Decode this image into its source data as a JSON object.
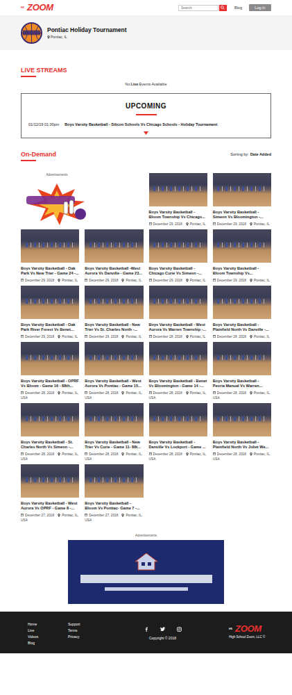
{
  "header": {
    "logo": {
      "small": "HS",
      "name": "ZOOM"
    },
    "search": {
      "placeholder": "Search"
    },
    "links": [
      "Blog"
    ],
    "login": "Log In"
  },
  "profile": {
    "name": "Pontiac Holiday Tournament",
    "location": "Pontiac, IL"
  },
  "live": {
    "title": "LIVE STREAMS",
    "empty": {
      "before": "No",
      "bold": "Live",
      "after": "Events Available"
    }
  },
  "upcoming": {
    "title": "UPCOMING",
    "events": [
      {
        "time": "01/12/19 01:30pm",
        "title": "Boys Varsity Basketball - Silicon Schools Vs Chicago Schools - Holiday Tournament"
      }
    ]
  },
  "on_demand": {
    "title": "On-Demand",
    "sort_label": "Sorting by:",
    "sort_value": "Date Added"
  },
  "side_ad": {
    "label": "Advertisements"
  },
  "videos": [
    {
      "title": "Boys Varsity Basketball - Bloom Township Vs Chicago...",
      "date": "December 29, 2018",
      "location": "Pontiac, IL"
    },
    {
      "title": "Boys Varsity Basketball - Simeon Vs Bloomington -...",
      "date": "December 29, 2018",
      "location": "Pontiac, IL"
    },
    {
      "title": "Boys Varsity Basketball - Oak Park Vs New Trier - Game 24 -...",
      "date": "December 29, 2018",
      "location": "Pontiac, IL"
    },
    {
      "title": "Boys Varsity Basketball -West Aurora Vs Danville - Game 23...",
      "date": "December 29, 2018",
      "location": "Pontiac, IL"
    },
    {
      "title": "Boys Varsity Basketball - Chicago Curie Vs Simeon -...",
      "date": "December 29, 2018",
      "location": "Pontiac, IL"
    },
    {
      "title": "Boys Varsity Basketball - Bloom Township Vs...",
      "date": "December 29, 2018",
      "location": "Pontiac, IL"
    },
    {
      "title": "Boys Varsity Basketball - Oak Park River Forest Vs Benet...",
      "date": "December 29, 2018",
      "location": "Pontiac, IL"
    },
    {
      "title": "Boys Varsity Basketball - New Trier Vs St. Charles North -...",
      "date": "December 29, 2018",
      "location": "Pontiac, IL"
    },
    {
      "title": "Boys Varsity Basketball - West Aurora Vs Warren Township -...",
      "date": "December 28, 2018",
      "location": "Pontiac, IL"
    },
    {
      "title": "Boys Varsity Basketball - Plainfield North Vs Danville -...",
      "date": "December 28, 2018",
      "location": "Pontiac, IL"
    },
    {
      "title": "Boys Varsity Basketball - OPRF Vs Bloom - Game 16 - 88th...",
      "date": "December 28, 2018",
      "location": "Pontiac, IL, USA"
    },
    {
      "title": "Boys Varsity Basketball - West Aurora Vs Pontiac - Game 15...",
      "date": "December 28, 2018",
      "location": "Pontiac, IL, USA"
    },
    {
      "title": "Boys Varsity Basketball - Benet Vs Bloomington - Game 14 -...",
      "date": "December 28, 2018",
      "location": "Pontiac, IL, USA"
    },
    {
      "title": "Boys Varsity Basketball - Peoria Manual Vs Warren...",
      "date": "December 28, 2018",
      "location": "Pontiac, IL, USA"
    },
    {
      "title": "Boys Varsity Basketball - St. Charles North Vs Simeon -...",
      "date": "December 28, 2018",
      "location": "Pontiac, IL, USA"
    },
    {
      "title": "Boys Varsity Basketball - New Trier Vs Curie - Game 11- 88t...",
      "date": "December 28, 2018",
      "location": "Pontiac, IL, USA"
    },
    {
      "title": "Boys Varsity Basketball - Danville Vs Lockport - Game ...",
      "date": "December 28, 2018",
      "location": "Pontiac, IL, USA"
    },
    {
      "title": "Boys Varsity Basketball - Plainfield North Vs Joliet We...",
      "date": "December 28, 2018",
      "location": "Pontiac, IL, USA"
    },
    {
      "title": "Boys Varsity Basketball - West Aurora Vs OPRF - Game 8 -...",
      "date": "December 27, 2018",
      "location": "Pontiac, IL, USA"
    },
    {
      "title": "Boys Varsity Basketball - Bloom Vs Pontiac- Game 7 -...",
      "date": "December 27, 2018",
      "location": "Pontiac, IL, USA"
    }
  ],
  "banner_ad": {
    "label": "Advertisements"
  },
  "footer": {
    "links_left": [
      "Home",
      "Live",
      "Videos",
      "Blog"
    ],
    "links_right": [
      "Support",
      "Terms",
      "Privacy"
    ],
    "copyright": "Copyright © 2018",
    "logo": {
      "small": "HS",
      "name": "ZOOM"
    },
    "company": "High School Zoom, LLC ©"
  }
}
